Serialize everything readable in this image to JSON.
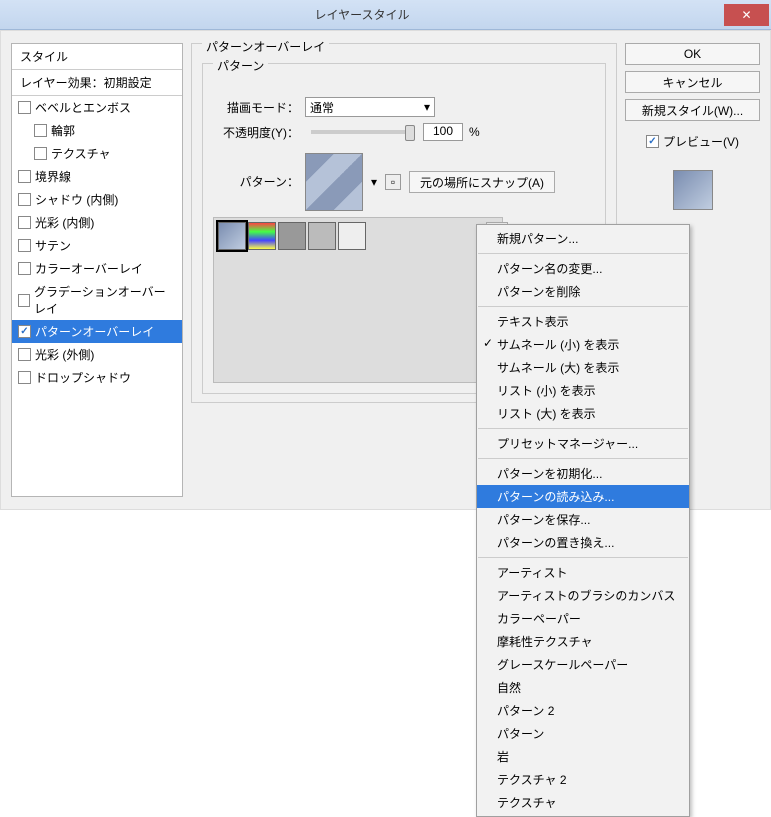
{
  "window": {
    "title": "レイヤースタイル"
  },
  "styles": {
    "header": "スタイル",
    "subheader": "レイヤー効果：初期設定",
    "items": [
      {
        "label": "ベベルとエンボス",
        "checked": false,
        "indent": false
      },
      {
        "label": "輪郭",
        "checked": false,
        "indent": true
      },
      {
        "label": "テクスチャ",
        "checked": false,
        "indent": true
      },
      {
        "label": "境界線",
        "checked": false,
        "indent": false
      },
      {
        "label": "シャドウ (内側)",
        "checked": false,
        "indent": false
      },
      {
        "label": "光彩 (内側)",
        "checked": false,
        "indent": false
      },
      {
        "label": "サテン",
        "checked": false,
        "indent": false
      },
      {
        "label": "カラーオーバーレイ",
        "checked": false,
        "indent": false
      },
      {
        "label": "グラデーションオーバーレイ",
        "checked": false,
        "indent": false
      },
      {
        "label": "パターンオーバーレイ",
        "checked": true,
        "indent": false,
        "selected": true
      },
      {
        "label": "光彩 (外側)",
        "checked": false,
        "indent": false
      },
      {
        "label": "ドロップシャドウ",
        "checked": false,
        "indent": false
      }
    ]
  },
  "overlay": {
    "group_title": "パターンオーバーレイ",
    "inner_title": "パターン",
    "blend_label": "描画モード：",
    "blend_value": "通常",
    "opacity_label": "不透明度(Y)：",
    "opacity_value": "100",
    "opacity_unit": "%",
    "pattern_label": "パターン：",
    "snap_btn": "元の場所にスナップ(A)"
  },
  "buttons": {
    "ok": "OK",
    "cancel": "キャンセル",
    "new_style": "新規スタイル(W)...",
    "preview": "プレビュー(V)"
  },
  "menu": {
    "items": [
      {
        "label": "新規パターン..."
      },
      {
        "sep": true
      },
      {
        "label": "パターン名の変更..."
      },
      {
        "label": "パターンを削除"
      },
      {
        "sep": true
      },
      {
        "label": "テキスト表示"
      },
      {
        "label": "サムネール (小) を表示",
        "checked": true
      },
      {
        "label": "サムネール (大) を表示"
      },
      {
        "label": "リスト (小) を表示"
      },
      {
        "label": "リスト (大) を表示"
      },
      {
        "sep": true
      },
      {
        "label": "プリセットマネージャー..."
      },
      {
        "sep": true
      },
      {
        "label": "パターンを初期化..."
      },
      {
        "label": "パターンの読み込み...",
        "highlight": true
      },
      {
        "label": "パターンを保存..."
      },
      {
        "label": "パターンの置き換え..."
      },
      {
        "sep": true
      },
      {
        "label": "アーティスト"
      },
      {
        "label": "アーティストのブラシのカンバス"
      },
      {
        "label": "カラーペーパー"
      },
      {
        "label": "摩耗性テクスチャ"
      },
      {
        "label": "グレースケールペーパー"
      },
      {
        "label": "自然"
      },
      {
        "label": "パターン 2"
      },
      {
        "label": "パターン"
      },
      {
        "label": "岩"
      },
      {
        "label": "テクスチャ 2"
      },
      {
        "label": "テクスチャ"
      }
    ]
  }
}
